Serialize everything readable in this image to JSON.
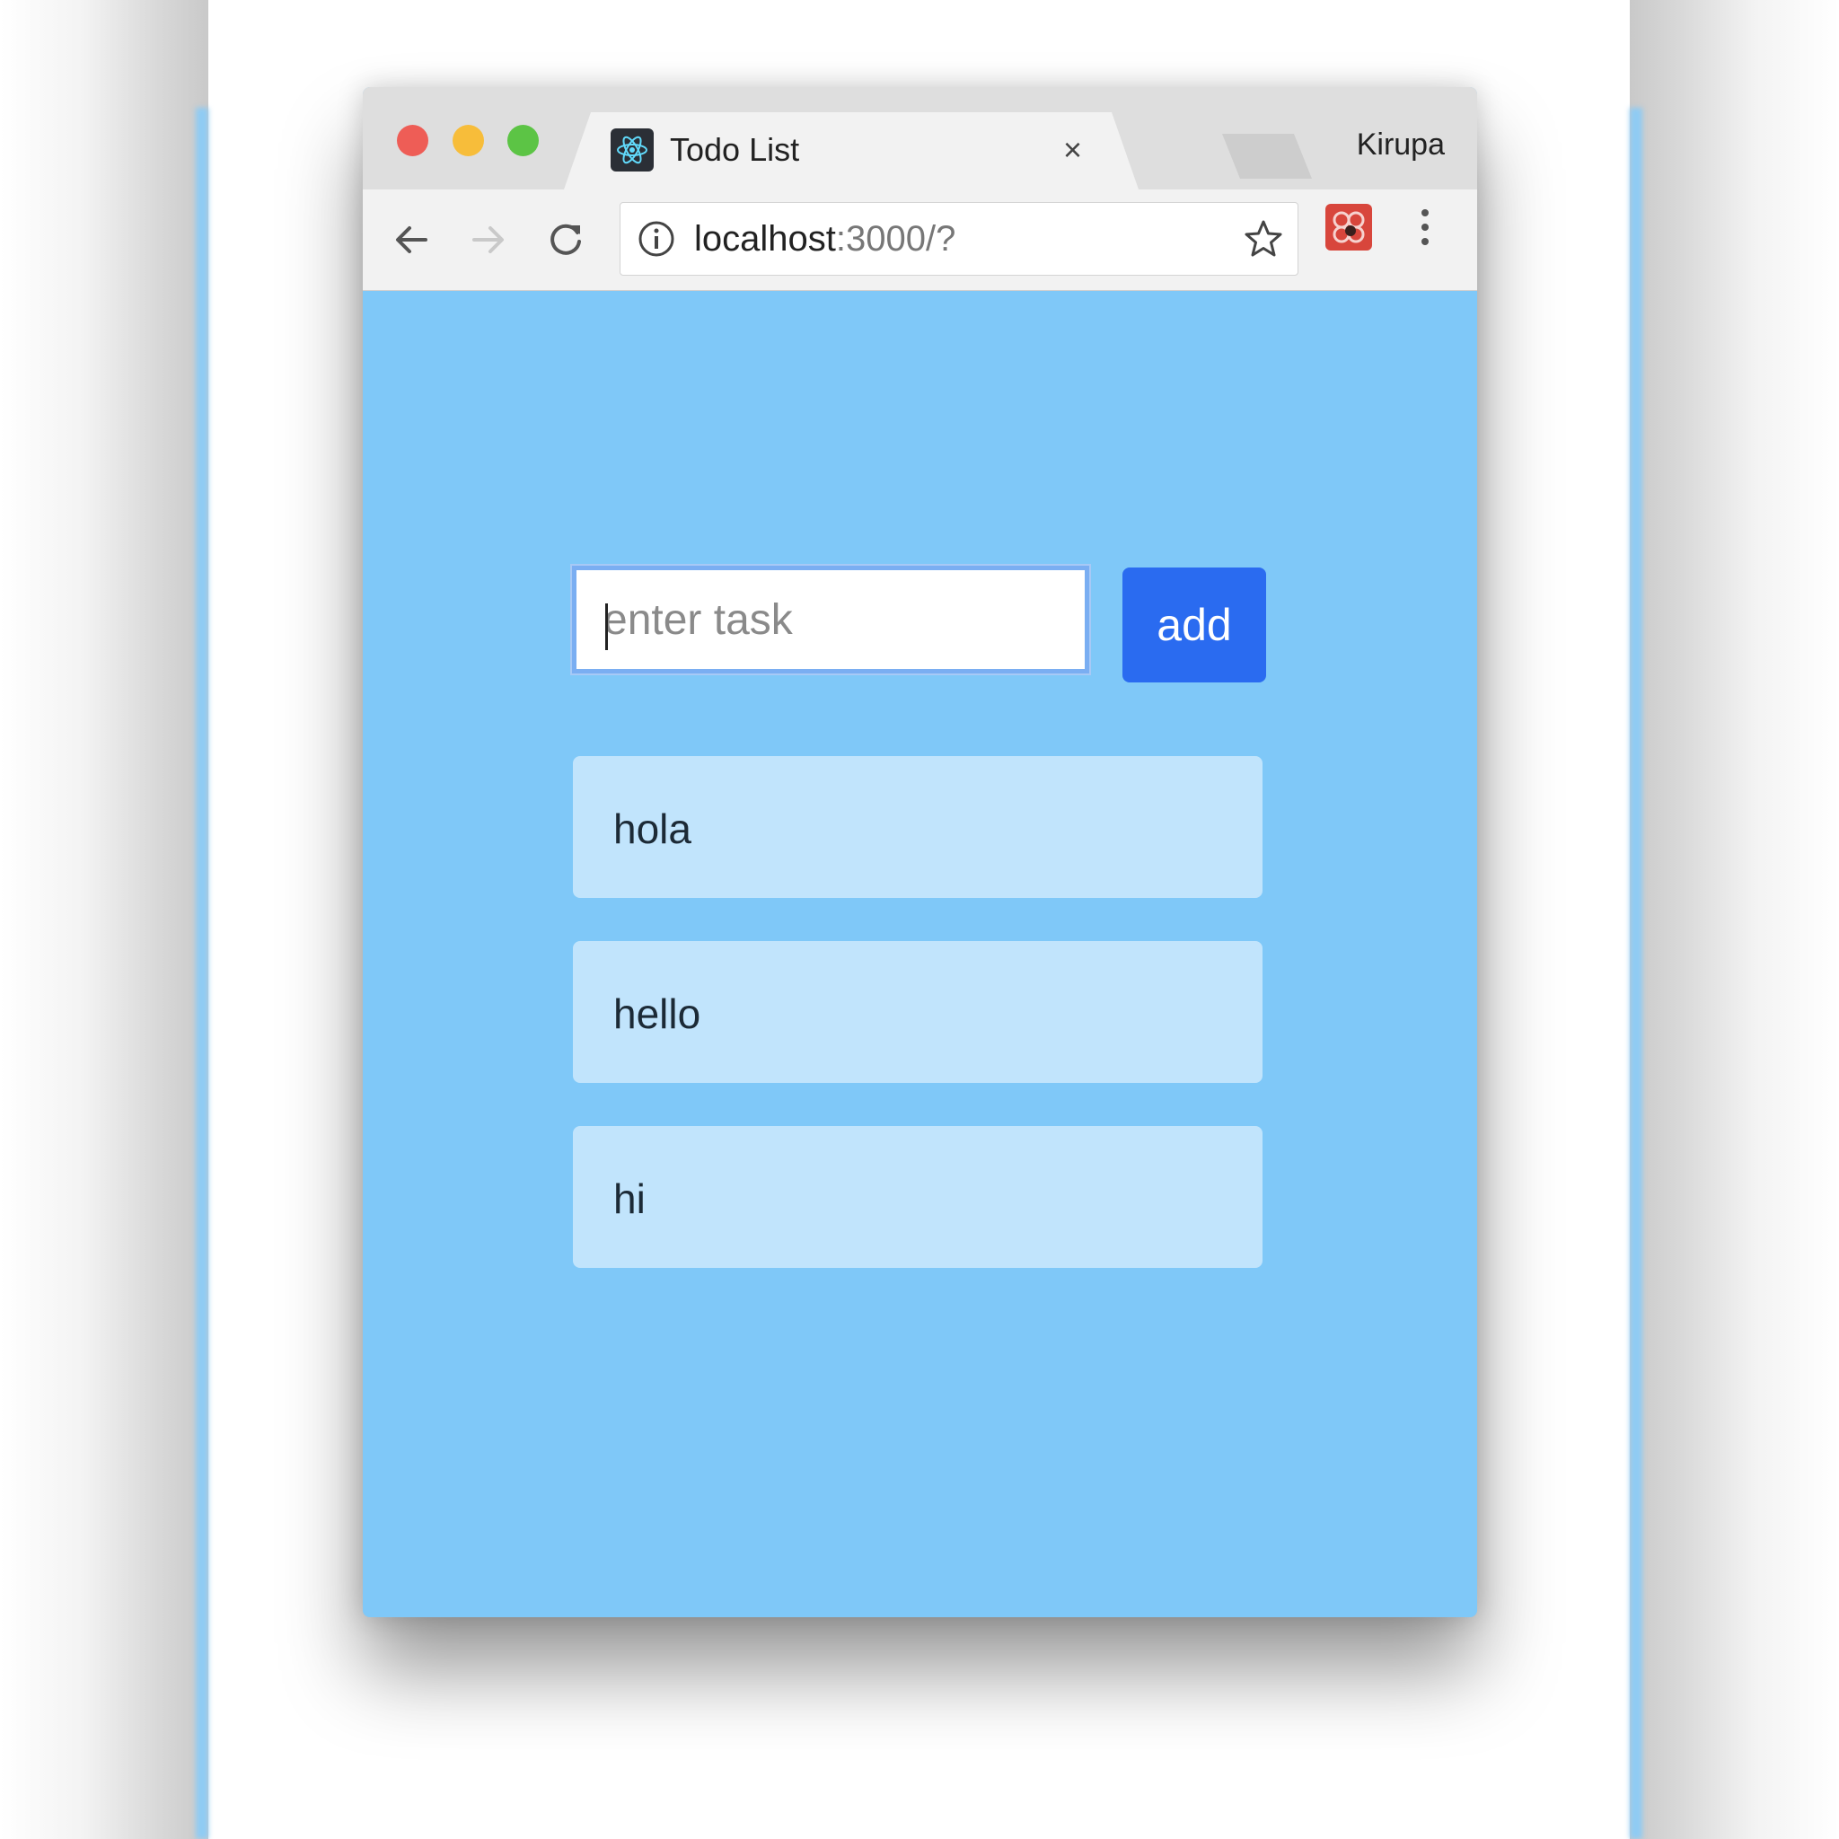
{
  "browser": {
    "tab_title": "Todo List",
    "tab_close": "×",
    "profile_name": "Kirupa",
    "url_host": "localhost",
    "url_rest": ":3000/?"
  },
  "icons": {
    "back": "back-arrow-icon",
    "forward": "forward-arrow-icon",
    "reload": "reload-icon",
    "info": "info-icon",
    "bookmark": "star-icon",
    "extension": "extension-icon",
    "menu": "more-menu-icon",
    "favicon": "react-logo-icon"
  },
  "colors": {
    "page_background": "#7fc8f8",
    "item_background": "#c1e4fc",
    "add_button": "#2a6bf0"
  },
  "todo": {
    "input_placeholder": "enter task",
    "input_value": "",
    "add_label": "add",
    "items": [
      {
        "text": "hola"
      },
      {
        "text": "hello"
      },
      {
        "text": "hi"
      }
    ]
  }
}
